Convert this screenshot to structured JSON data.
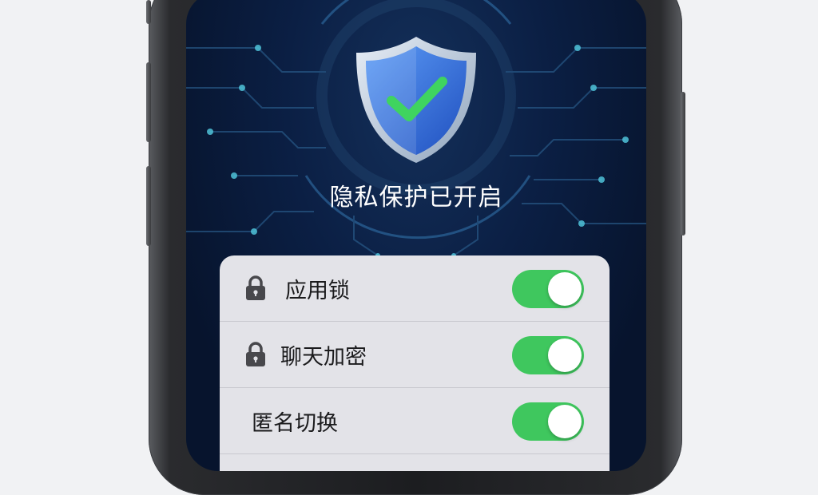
{
  "status": {
    "title": "隐私保护已开启",
    "shield_icon": "shield-check-icon",
    "shield_color": "#2f6fe0",
    "check_color": "#3fd45f"
  },
  "settings": {
    "items": [
      {
        "label": "应用锁",
        "icon": "lock-icon",
        "enabled": true
      },
      {
        "label": "聊天加密",
        "icon": "lock-icon",
        "enabled": true
      },
      {
        "label": "匿名切换",
        "icon": "",
        "enabled": true
      }
    ],
    "toggle_on_color": "#3fc75e"
  }
}
